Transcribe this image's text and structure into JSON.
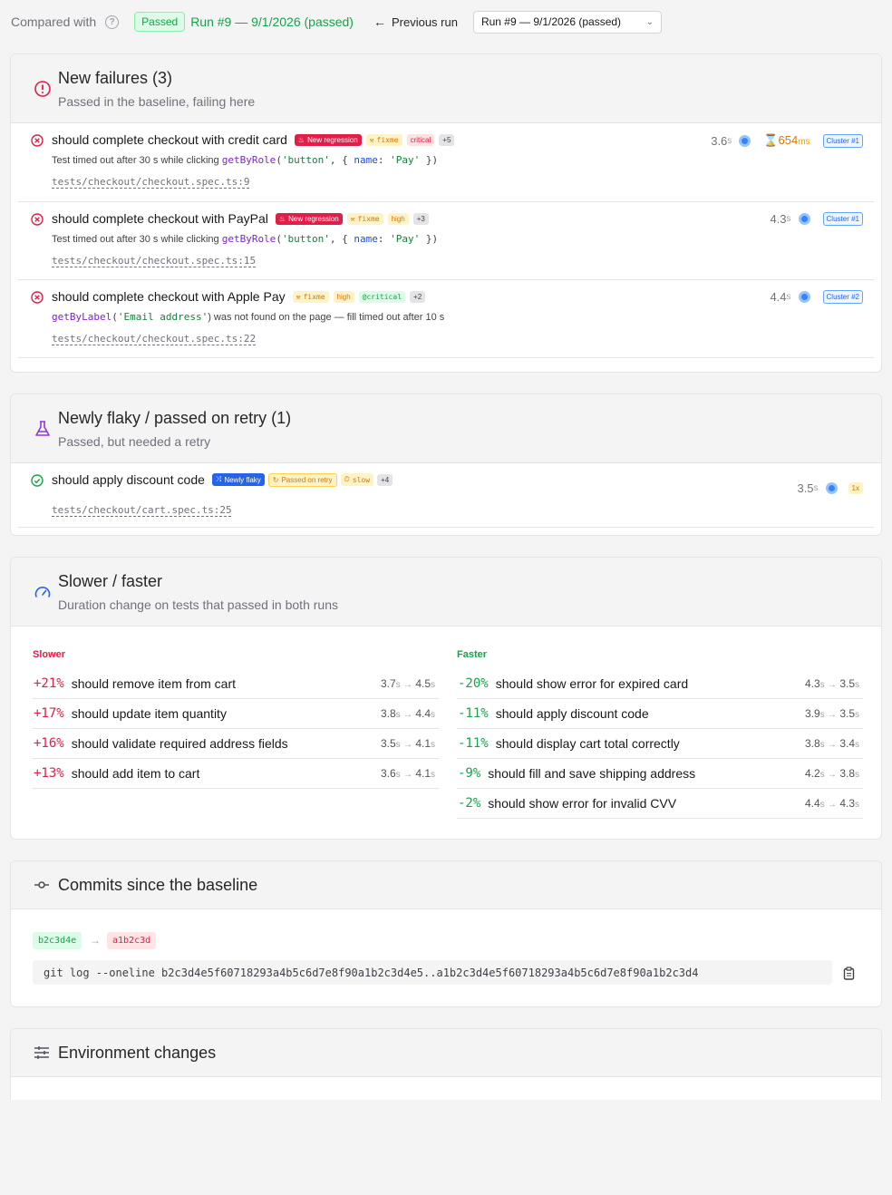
{
  "topbar": {
    "compared_with": "Compared with",
    "badge": "Passed",
    "run_link": "Run #9 — 9/1/2026 (passed)",
    "previous_run": "Previous run",
    "select_value": "Run #9 — 9/1/2026 (passed)"
  },
  "failures": {
    "title": "New failures (3)",
    "subtitle": "Passed in the baseline, failing here",
    "items": [
      {
        "name": "should complete checkout with credit card",
        "tags": [
          "New regression",
          "fixme",
          "critical",
          "+5"
        ],
        "error_pre": "Test timed out after 30 s while clicking ",
        "error_fn": "getByRole",
        "error_a": "(",
        "error_s1": "'button'",
        "error_b": ", { ",
        "error_kw": "name",
        "error_c": ": ",
        "error_s2": "'Pay'",
        "error_d": " })",
        "path": "tests/checkout/checkout.spec.ts:9",
        "duration": "3.6",
        "unit": "s",
        "slow": "654",
        "slow_unit": "ms",
        "cluster": "Cluster #1"
      },
      {
        "name": "should complete checkout with PayPal",
        "tags": [
          "New regression",
          "fixme",
          "high",
          "+3"
        ],
        "error_pre": "Test timed out after 30 s while clicking ",
        "error_fn": "getByRole",
        "error_a": "(",
        "error_s1": "'button'",
        "error_b": ", { ",
        "error_kw": "name",
        "error_c": ": ",
        "error_s2": "'Pay'",
        "error_d": " })",
        "path": "tests/checkout/checkout.spec.ts:15",
        "duration": "4.3",
        "unit": "s",
        "cluster": "Cluster #1"
      },
      {
        "name": "should complete checkout with Apple Pay",
        "tags": [
          "fixme",
          "high",
          "@critical",
          "+2"
        ],
        "error_fn": "getByLabel",
        "error_a": "(",
        "error_s1": "'Email address'",
        "error_rest": ") was not found on the page — fill timed out after 10 s",
        "path": "tests/checkout/checkout.spec.ts:22",
        "duration": "4.4",
        "unit": "s",
        "cluster": "Cluster #2"
      }
    ]
  },
  "flaky": {
    "title": "Newly flaky / passed on retry (1)",
    "subtitle": "Passed, but needed a retry",
    "items": [
      {
        "name": "should apply discount code",
        "tags": [
          "Newly flaky",
          "Passed on retry",
          "slow",
          "+4"
        ],
        "path": "tests/checkout/cart.spec.ts:25",
        "duration": "3.5",
        "unit": "s",
        "retries": "1x"
      }
    ]
  },
  "perf": {
    "title": "Slower / faster",
    "subtitle": "Duration change on tests that passed in both runs",
    "slower_label": "Slower",
    "faster_label": "Faster",
    "arrow": "→",
    "unit": "s",
    "slower": [
      {
        "pct": "+21%",
        "name": "should remove item from cart",
        "from": "3.7",
        "to": "4.5"
      },
      {
        "pct": "+17%",
        "name": "should update item quantity",
        "from": "3.8",
        "to": "4.4"
      },
      {
        "pct": "+16%",
        "name": "should validate required address fields",
        "from": "3.5",
        "to": "4.1"
      },
      {
        "pct": "+13%",
        "name": "should add item to cart",
        "from": "3.6",
        "to": "4.1"
      }
    ],
    "faster": [
      {
        "pct": "-20%",
        "name": "should show error for expired card",
        "from": "4.3",
        "to": "3.5"
      },
      {
        "pct": "-11%",
        "name": "should apply discount code",
        "from": "3.9",
        "to": "3.5"
      },
      {
        "pct": "-11%",
        "name": "should display cart total correctly",
        "from": "3.8",
        "to": "3.4"
      },
      {
        "pct": "-9%",
        "name": "should fill and save shipping address",
        "from": "4.2",
        "to": "3.8"
      },
      {
        "pct": "-2%",
        "name": "should show error for invalid CVV",
        "from": "4.4",
        "to": "4.3"
      }
    ],
    "slower_color": "#e11d48",
    "faster_color": "#16a34a"
  },
  "commits": {
    "title": "Commits since the baseline",
    "from_hash": "b2c3d4e",
    "to_hash": "a1b2c3d",
    "git_cmd": "git log --oneline b2c3d4e5f60718293a4b5c6d7e8f90a1b2c3d4e5..a1b2c3d4e5f60718293a4b5c6d7e8f90a1b2c3d4"
  },
  "env": {
    "title": "Environment changes"
  }
}
